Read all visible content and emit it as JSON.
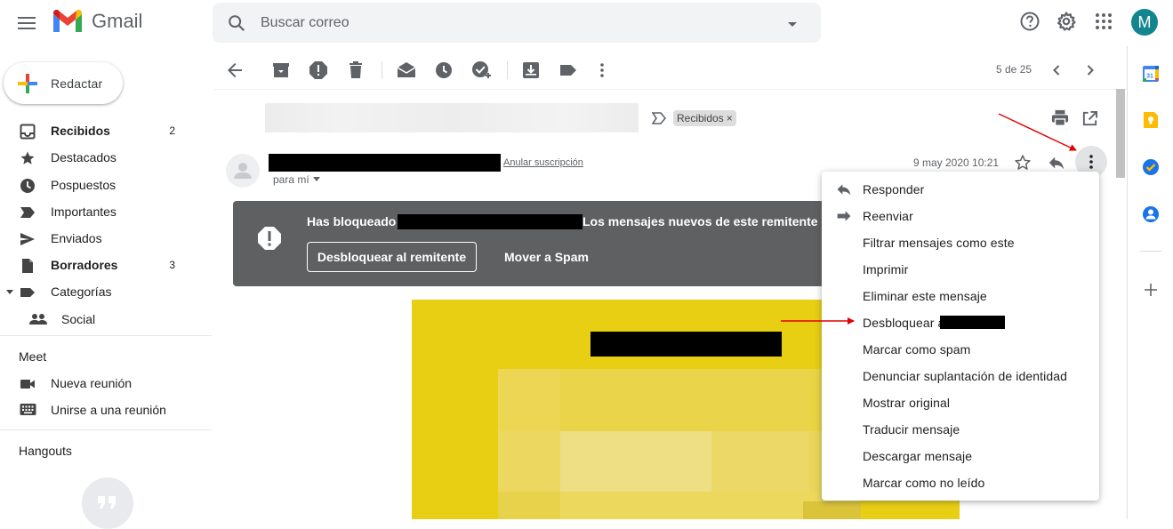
{
  "app": {
    "name": "Gmail"
  },
  "search": {
    "placeholder": "Buscar correo"
  },
  "account": {
    "avatar_letter": "M",
    "avatar_color": "#12858f"
  },
  "compose": {
    "label": "Redactar"
  },
  "sidebar": {
    "items": [
      {
        "label": "Recibidos",
        "count": "2",
        "icon": "inbox-icon",
        "bold": true
      },
      {
        "label": "Destacados",
        "count": "",
        "icon": "star-icon"
      },
      {
        "label": "Pospuestos",
        "count": "",
        "icon": "clock-icon"
      },
      {
        "label": "Importantes",
        "count": "",
        "icon": "label-important-icon"
      },
      {
        "label": "Enviados",
        "count": "",
        "icon": "send-icon"
      },
      {
        "label": "Borradores",
        "count": "3",
        "icon": "draft-icon",
        "bold": true
      },
      {
        "label": "Categorías",
        "count": "",
        "icon": "label-icon"
      },
      {
        "label": "Social",
        "count": "",
        "icon": "people-icon"
      }
    ],
    "meet_title": "Meet",
    "meet_items": [
      {
        "label": "Nueva reunión",
        "icon": "video-icon"
      },
      {
        "label": "Unirse a una reunión",
        "icon": "keyboard-icon"
      }
    ],
    "hangouts_title": "Hangouts"
  },
  "toolbar": {
    "pager": "5 de 25"
  },
  "message": {
    "label_chip": "Recibidos",
    "unsubscribe": "Anular suscripción",
    "to_me": "para mí",
    "date": "9 may 2020 10:21"
  },
  "banner": {
    "text_prefix": "Has bloqueado a",
    "text_suffix": "Los mensajes nuevos de este remitente se e",
    "unblock_button": "Desbloquear al remitente",
    "spam_button": "Mover a Spam",
    "background": "#5f6061"
  },
  "menu": {
    "items": [
      {
        "label": "Responder",
        "icon": "reply-icon"
      },
      {
        "label": "Reenviar",
        "icon": "forward-icon"
      },
      {
        "label": "Filtrar mensajes como este"
      },
      {
        "label": "Imprimir"
      },
      {
        "label": "Eliminar este mensaje"
      },
      {
        "label": "Desbloquear a"
      },
      {
        "label": "Marcar como spam"
      },
      {
        "label": "Denunciar suplantación de identidad"
      },
      {
        "label": "Mostrar original"
      },
      {
        "label": "Traducir mensaje"
      },
      {
        "label": "Descargar mensaje"
      },
      {
        "label": "Marcar como no leído"
      }
    ]
  },
  "colors": {
    "annotation_arrow": "#e00000",
    "email_body": "#e8cf14"
  }
}
